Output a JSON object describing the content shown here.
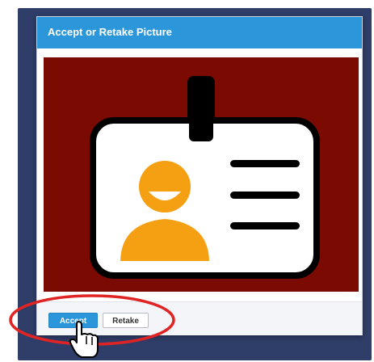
{
  "dialog": {
    "title": "Accept or Retake Picture",
    "accept_label": "Accept",
    "retake_label": "Retake"
  },
  "photo": {
    "icons": [
      "id-badge-icon",
      "person-avatar-icon",
      "text-lines-icon"
    ]
  },
  "annotation": {
    "icons": [
      "red-circle-highlight",
      "hand-pointer-cursor-icon"
    ]
  },
  "colors": {
    "backdrop": "#2f3e68",
    "title_bar": "#2c96db",
    "photo_background": "#7b0b02",
    "avatar": "#f5a012",
    "highlight": "#e02424"
  }
}
